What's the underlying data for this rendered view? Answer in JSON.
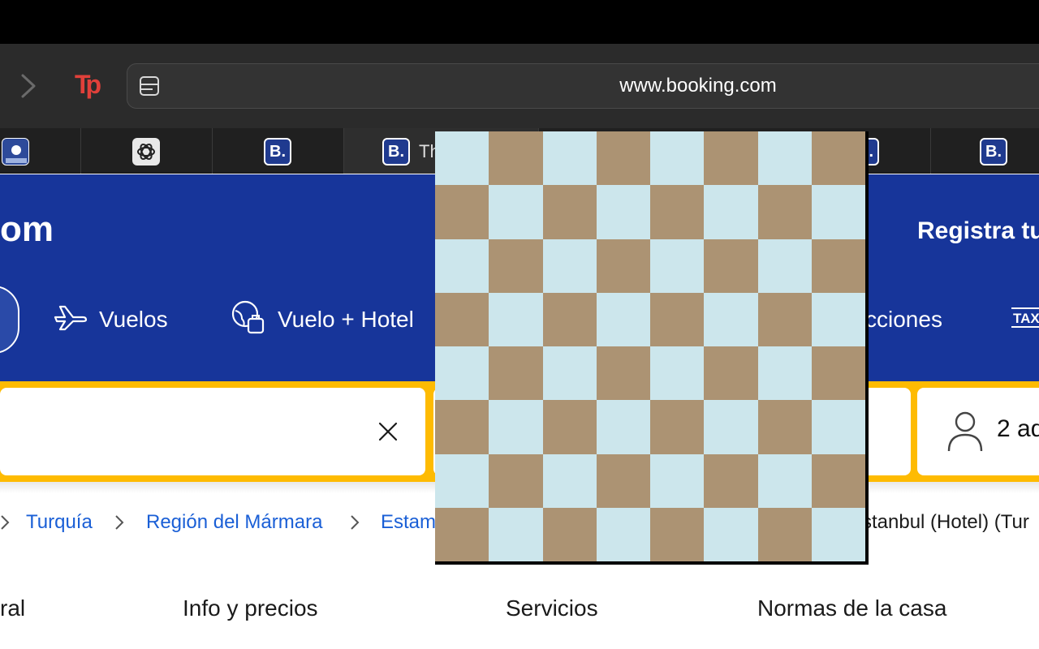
{
  "browser": {
    "url": "www.booking.com",
    "icons": [
      "forward-icon",
      "travelpayouts-icon",
      "reader-icon"
    ],
    "tp_logo_text": "Tp"
  },
  "tabs": [
    {
      "favicon": "jasna-icon",
      "title": ""
    },
    {
      "favicon": "chatgpt-icon",
      "title": ""
    },
    {
      "favicon": "booking-icon",
      "favicon_text": "B.",
      "title": ""
    },
    {
      "favicon": "booking-icon",
      "favicon_text": "B.",
      "title": "Th",
      "active": true
    },
    {
      "favicon": "booking-icon",
      "favicon_text": "B.",
      "title": ""
    },
    {
      "favicon": "booking-icon",
      "favicon_text": "B.",
      "title": ""
    }
  ],
  "header": {
    "logo": "om",
    "register": "Registra tu",
    "nav": [
      {
        "label": "Vuelos",
        "icon": "plane-icon"
      },
      {
        "label": "Vuelo + Hotel",
        "icon": "globe-luggage-icon"
      },
      {
        "label": "cciones",
        "icon": "attractions-icon"
      },
      {
        "label": "",
        "icon": "taxi-icon"
      }
    ]
  },
  "search": {
    "destination_value": "",
    "guests": "2 ad"
  },
  "breadcrumb": [
    {
      "label": "Turquía",
      "link": true
    },
    {
      "label": "Región del Mármara",
      "link": true
    },
    {
      "label": "Estam",
      "link": true
    },
    {
      "label": "stanbul (Hotel) (Tur",
      "link": false
    }
  ],
  "property_tabs": [
    "ral",
    "Info y precios",
    "Servicios",
    "Normas de la casa"
  ],
  "overlay": {
    "type": "checkerboard",
    "rows": 8,
    "cols": 8,
    "colors": {
      "light": "#cce6ec",
      "dark": "#ac9373",
      "border": "#000000"
    }
  },
  "colors": {
    "brand_blue": "#17359a",
    "search_yellow": "#febb02",
    "link_blue": "#1a5fd6"
  }
}
